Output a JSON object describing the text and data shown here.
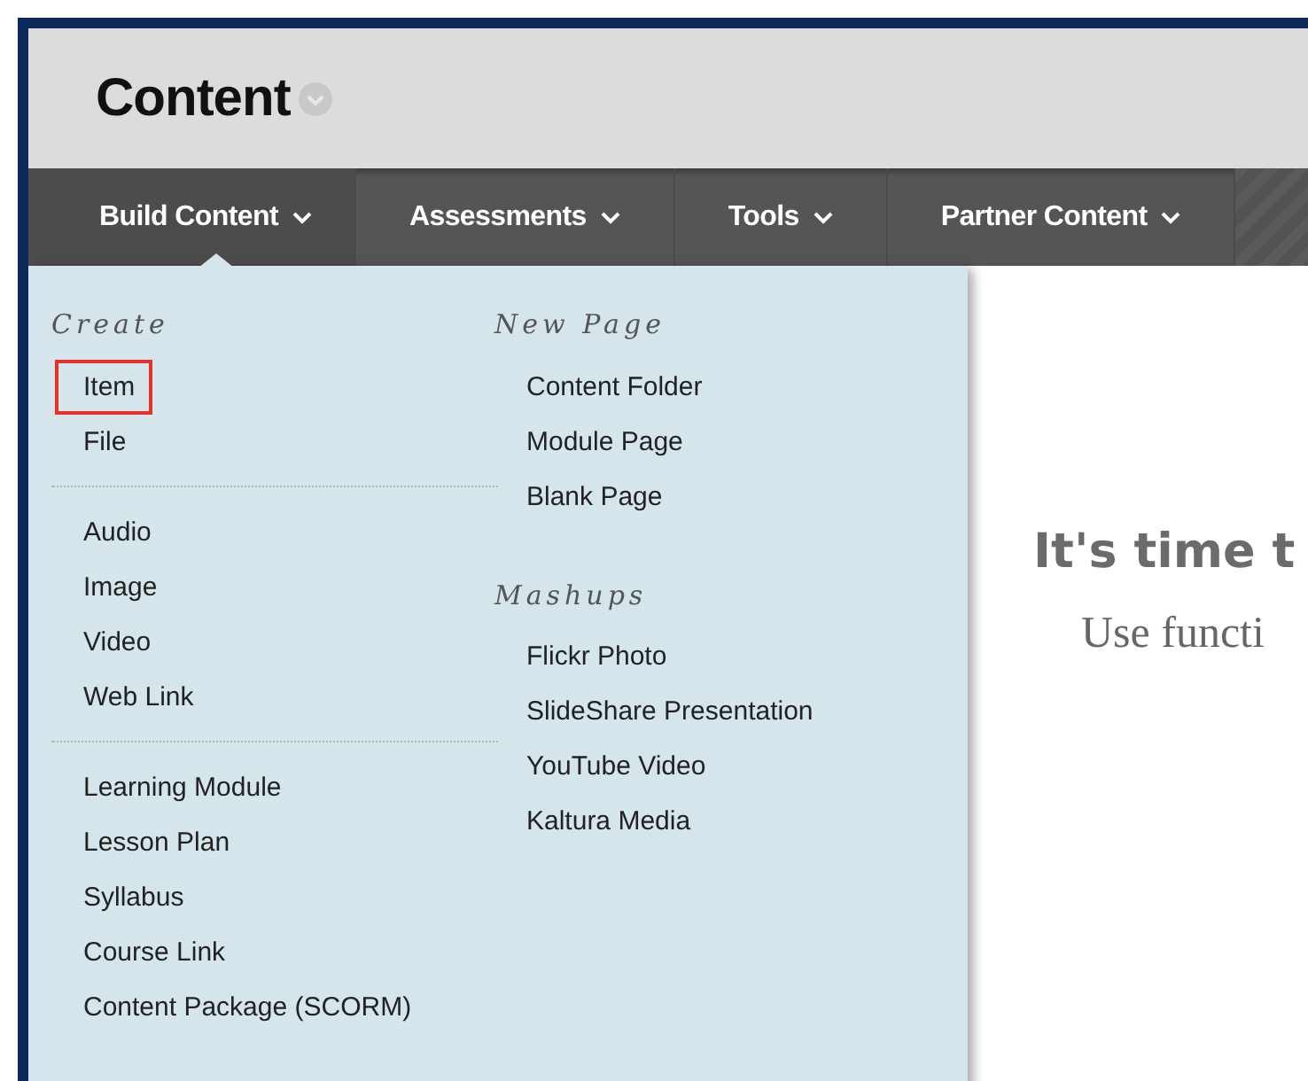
{
  "page_title": "Content",
  "nav": [
    {
      "label": "Build Content",
      "selected": true
    },
    {
      "label": "Assessments",
      "selected": false
    },
    {
      "label": "Tools",
      "selected": false
    },
    {
      "label": "Partner Content",
      "selected": false
    }
  ],
  "menu": {
    "columns": [
      {
        "sections": [
          {
            "heading": "Create",
            "groups": [
              [
                {
                  "label": "Item",
                  "highlighted": true
                },
                {
                  "label": "File",
                  "highlighted": false
                }
              ],
              [
                {
                  "label": "Audio",
                  "highlighted": false
                },
                {
                  "label": "Image",
                  "highlighted": false
                },
                {
                  "label": "Video",
                  "highlighted": false
                },
                {
                  "label": "Web Link",
                  "highlighted": false
                }
              ],
              [
                {
                  "label": "Learning Module",
                  "highlighted": false
                },
                {
                  "label": "Lesson Plan",
                  "highlighted": false
                },
                {
                  "label": "Syllabus",
                  "highlighted": false
                },
                {
                  "label": "Course Link",
                  "highlighted": false
                },
                {
                  "label": "Content Package (SCORM)",
                  "highlighted": false
                }
              ]
            ]
          }
        ]
      },
      {
        "sections": [
          {
            "heading": "New Page",
            "groups": [
              [
                {
                  "label": "Content Folder",
                  "highlighted": false
                },
                {
                  "label": "Module Page",
                  "highlighted": false
                },
                {
                  "label": "Blank Page",
                  "highlighted": false
                }
              ]
            ]
          },
          {
            "heading": "Mashups",
            "groups": [
              [
                {
                  "label": "Flickr Photo",
                  "highlighted": false
                },
                {
                  "label": "SlideShare Presentation",
                  "highlighted": false
                },
                {
                  "label": "YouTube Video",
                  "highlighted": false
                },
                {
                  "label": "Kaltura Media",
                  "highlighted": false
                }
              ]
            ]
          }
        ]
      }
    ]
  },
  "main": {
    "heading": "It's time t",
    "subtitle": "Use functi"
  }
}
